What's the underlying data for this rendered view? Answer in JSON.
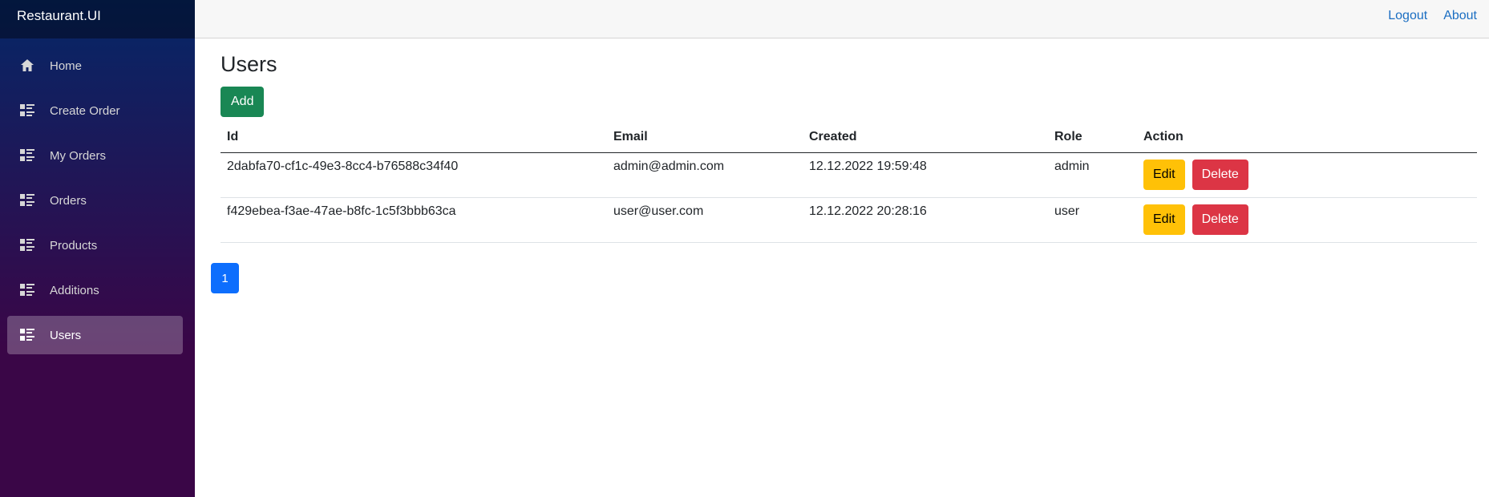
{
  "app": {
    "brand": "Restaurant.UI"
  },
  "sidebar": {
    "items": [
      {
        "label": "Home",
        "icon": "home-icon",
        "active": false
      },
      {
        "label": "Create Order",
        "icon": "list-rich-icon",
        "active": false
      },
      {
        "label": "My Orders",
        "icon": "list-rich-icon",
        "active": false
      },
      {
        "label": "Orders",
        "icon": "list-rich-icon",
        "active": false
      },
      {
        "label": "Products",
        "icon": "list-rich-icon",
        "active": false
      },
      {
        "label": "Additions",
        "icon": "list-rich-icon",
        "active": false
      },
      {
        "label": "Users",
        "icon": "list-rich-icon",
        "active": true
      }
    ]
  },
  "topbar": {
    "logout": "Logout",
    "about": "About"
  },
  "page": {
    "title": "Users",
    "add_label": "Add"
  },
  "table": {
    "headers": {
      "id": "Id",
      "email": "Email",
      "created": "Created",
      "role": "Role",
      "action": "Action"
    },
    "rows": [
      {
        "id": "2dabfa70-cf1c-49e3-8cc4-b76588c34f40",
        "email": "admin@admin.com",
        "created": "12.12.2022 19:59:48",
        "role": "admin",
        "edit": "Edit",
        "delete": "Delete"
      },
      {
        "id": "f429ebea-f3ae-47ae-b8fc-1c5f3bbb63ca",
        "email": "user@user.com",
        "created": "12.12.2022 20:28:16",
        "role": "user",
        "edit": "Edit",
        "delete": "Delete"
      }
    ]
  },
  "pagination": {
    "current": "1"
  },
  "colors": {
    "sidebar_top": "#052767",
    "sidebar_bottom": "#3a0647",
    "link": "#1b6ec2",
    "add": "#198754",
    "edit": "#ffc107",
    "delete": "#dc3545",
    "page": "#0d6efd"
  }
}
